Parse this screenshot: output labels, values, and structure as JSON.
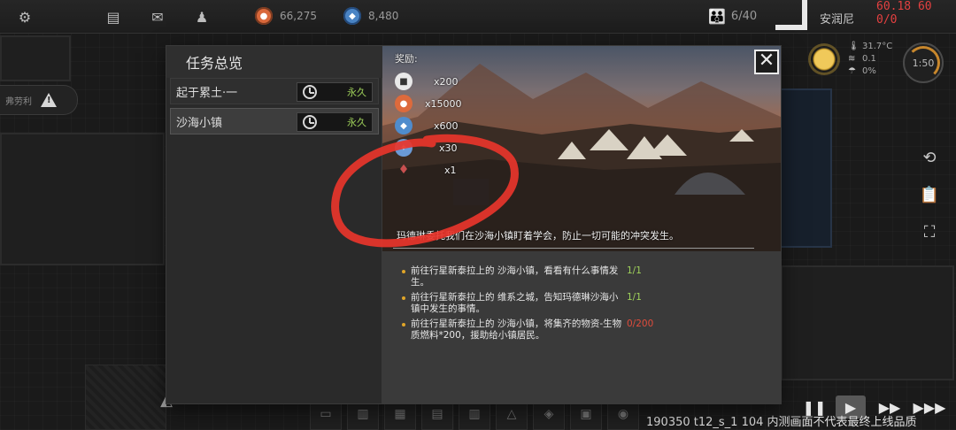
{
  "hud": {
    "resources": [
      {
        "icon": "orange-coin-icon",
        "value": "66,275"
      },
      {
        "icon": "blue-crystal-icon",
        "value": "8,480"
      }
    ],
    "population": "6/40",
    "location": "安润尼",
    "fps": "60.18 60 0/0",
    "side_notice": "弗劳利",
    "weather": {
      "temperature": "31.7°C",
      "wind": "0.1",
      "humidity": "0%"
    },
    "clock": "1:50"
  },
  "dialog": {
    "title": "任务总览",
    "quests": [
      {
        "name": "起于累土·一",
        "duration": "永久",
        "selected": false
      },
      {
        "name": "沙海小镇",
        "duration": "永久",
        "selected": true
      }
    ],
    "close_label": "✕",
    "rewards_heading": "奖励:",
    "rewards": [
      {
        "icon": "white-token-icon",
        "amount": "x200"
      },
      {
        "icon": "orange-coin-icon",
        "amount": "x15000"
      },
      {
        "icon": "blue-crystal-icon",
        "amount": "x600"
      },
      {
        "icon": "blue-gear-icon",
        "amount": "x30"
      },
      {
        "icon": "red-item-icon",
        "amount": "x1"
      }
    ],
    "description": "玛德琳委托我们在沙海小镇盯着学会，防止一切可能的冲突发生。",
    "objectives": [
      {
        "text": "前往行星新泰拉上的 沙海小镇，看看有什么事情发生。",
        "progress": "1/1",
        "done": true
      },
      {
        "text": "前往行星新泰拉上的 维系之城，告知玛德琳沙海小镇中发生的事情。",
        "progress": "1/1",
        "done": true
      },
      {
        "text": "前往行星新泰拉上的 沙海小镇，将集齐的物资-生物质燃料*200，援助给小镇居民。",
        "progress": "0/200",
        "done": false
      }
    ]
  },
  "footer": {
    "build_info": "190350 t12_s_1 104  内测画面不代表最终上线品质"
  },
  "colors": {
    "accent_orange": "#e0a528",
    "progress_done": "#9ed05a",
    "progress_todo": "#e04c3c",
    "annotation_red": "#e8352b",
    "fps_red": "#e34040"
  }
}
